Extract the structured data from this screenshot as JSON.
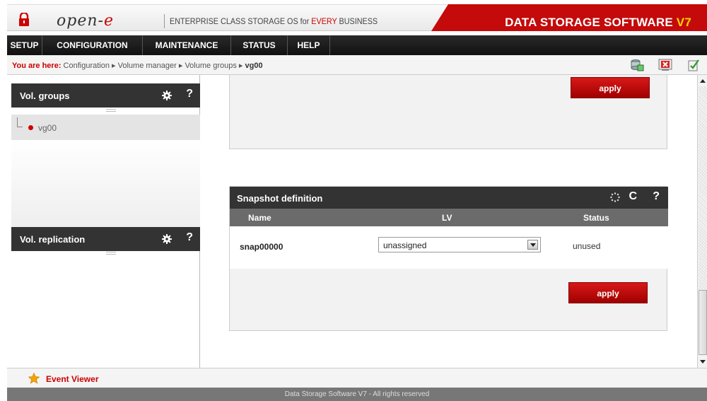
{
  "header": {
    "logo_text": "open-",
    "logo_accent": "e",
    "tagline_pre": "ENTERPRISE CLASS STORAGE OS for ",
    "tagline_accent": "EVERY",
    "tagline_post": " BUSINESS",
    "brand_main": "DATA STORAGE SOFTWARE ",
    "brand_version": "V7",
    "brand_color": "#c40a0a"
  },
  "menu": {
    "items": [
      {
        "label": "SETUP"
      },
      {
        "label": "CONFIGURATION"
      },
      {
        "label": "MAINTENANCE"
      },
      {
        "label": "STATUS"
      },
      {
        "label": "HELP"
      }
    ]
  },
  "breadcrumb": {
    "label": "You are here:",
    "path": [
      " Configuration",
      "Volume manager",
      "Volume groups"
    ],
    "separator": " ▸ ",
    "current": "vg00"
  },
  "left": {
    "vol_groups_title": "Vol. groups",
    "vol_groups_item": "vg00",
    "vol_replication_title": "Vol. replication",
    "help_glyph": "?"
  },
  "main": {
    "apply_label": "apply",
    "snapshot": {
      "title": "Snapshot definition",
      "refresh_glyph": "C",
      "help_glyph": "?",
      "col_name": "Name",
      "col_lv": "LV",
      "col_status": "Status",
      "row_name": "snap00000",
      "row_lv": "unassigned",
      "row_status": "unused",
      "apply_label": "apply"
    }
  },
  "event_viewer": {
    "label": "Event Viewer"
  },
  "footer": {
    "text": "Data Storage Software V7 - All rights reserved"
  },
  "icons": {
    "lock": "lock-icon",
    "gear": "gear-icon",
    "help": "help-icon",
    "spinner": "spinner-icon",
    "refresh": "refresh-icon",
    "star": "star-icon",
    "bc_icons": [
      "database-icon",
      "close-icon",
      "checklist-icon"
    ]
  }
}
